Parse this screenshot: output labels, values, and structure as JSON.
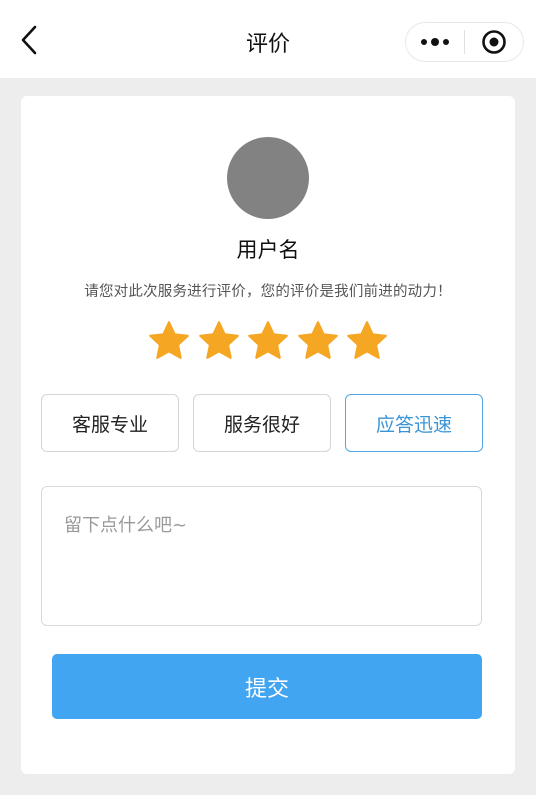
{
  "navbar": {
    "title": "评价",
    "back_icon": "chevron-left-icon",
    "more_icon": "more-dots-icon",
    "close_icon": "target-circle-icon"
  },
  "profile": {
    "username": "用户名",
    "prompt": "请您对此次服务进行评价，您的评价是我们前进的动力！"
  },
  "rating": {
    "stars": 5,
    "max": 5,
    "star_color": "#f5a623"
  },
  "tags": [
    {
      "label": "客服专业",
      "selected": false
    },
    {
      "label": "服务很好",
      "selected": false
    },
    {
      "label": "应答迅速",
      "selected": true
    }
  ],
  "comment": {
    "placeholder": "留下点什么吧~"
  },
  "submit": {
    "label": "提交",
    "color": "#42a5f1"
  },
  "colors": {
    "accent": "#4ea6e6",
    "background": "#ededed"
  }
}
